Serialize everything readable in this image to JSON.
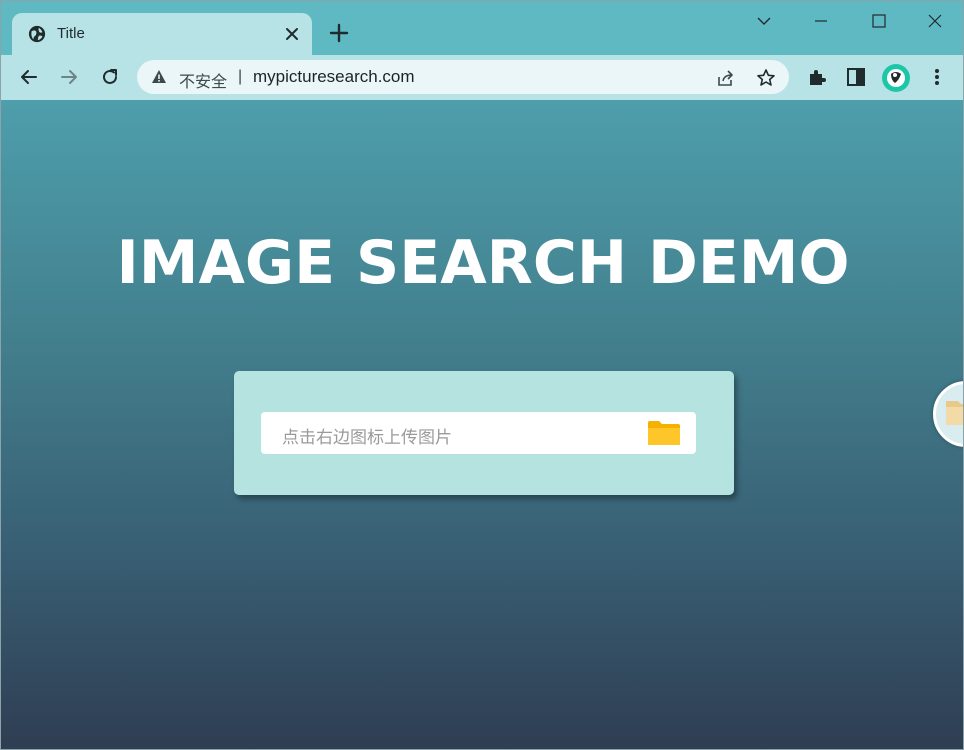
{
  "browser": {
    "tab": {
      "title": "Title",
      "favicon": "globe-icon",
      "close_icon": "close-icon"
    },
    "new_tab_icon": "plus-icon",
    "window_controls": [
      "chevron-down-icon",
      "minimize-icon",
      "maximize-icon",
      "close-icon"
    ],
    "nav": [
      "back-arrow-icon",
      "forward-arrow-icon",
      "reload-icon"
    ],
    "address_bar": {
      "security_label": "不安全",
      "separator": "|",
      "url": "mypicturesearch.com",
      "icons": [
        "warning-icon",
        "share-icon",
        "star-icon"
      ]
    },
    "toolbar_icons": [
      "extensions-icon",
      "side-panel-icon",
      "profile-avatar",
      "more-menu-icon"
    ]
  },
  "page": {
    "title": "IMAGE SEARCH DEMO",
    "upload": {
      "placeholder": "点击右边图标上传图片",
      "icon": "folder-icon"
    },
    "floating_button_icon": "folder-icon"
  },
  "colors": {
    "tabstrip": "#5fb9c3",
    "toolbar": "#b8e3e6",
    "gradient_top": "#4e9eac",
    "gradient_bottom": "#2f3d52",
    "card": "#b5e3e0",
    "folder": "#ffc629"
  }
}
